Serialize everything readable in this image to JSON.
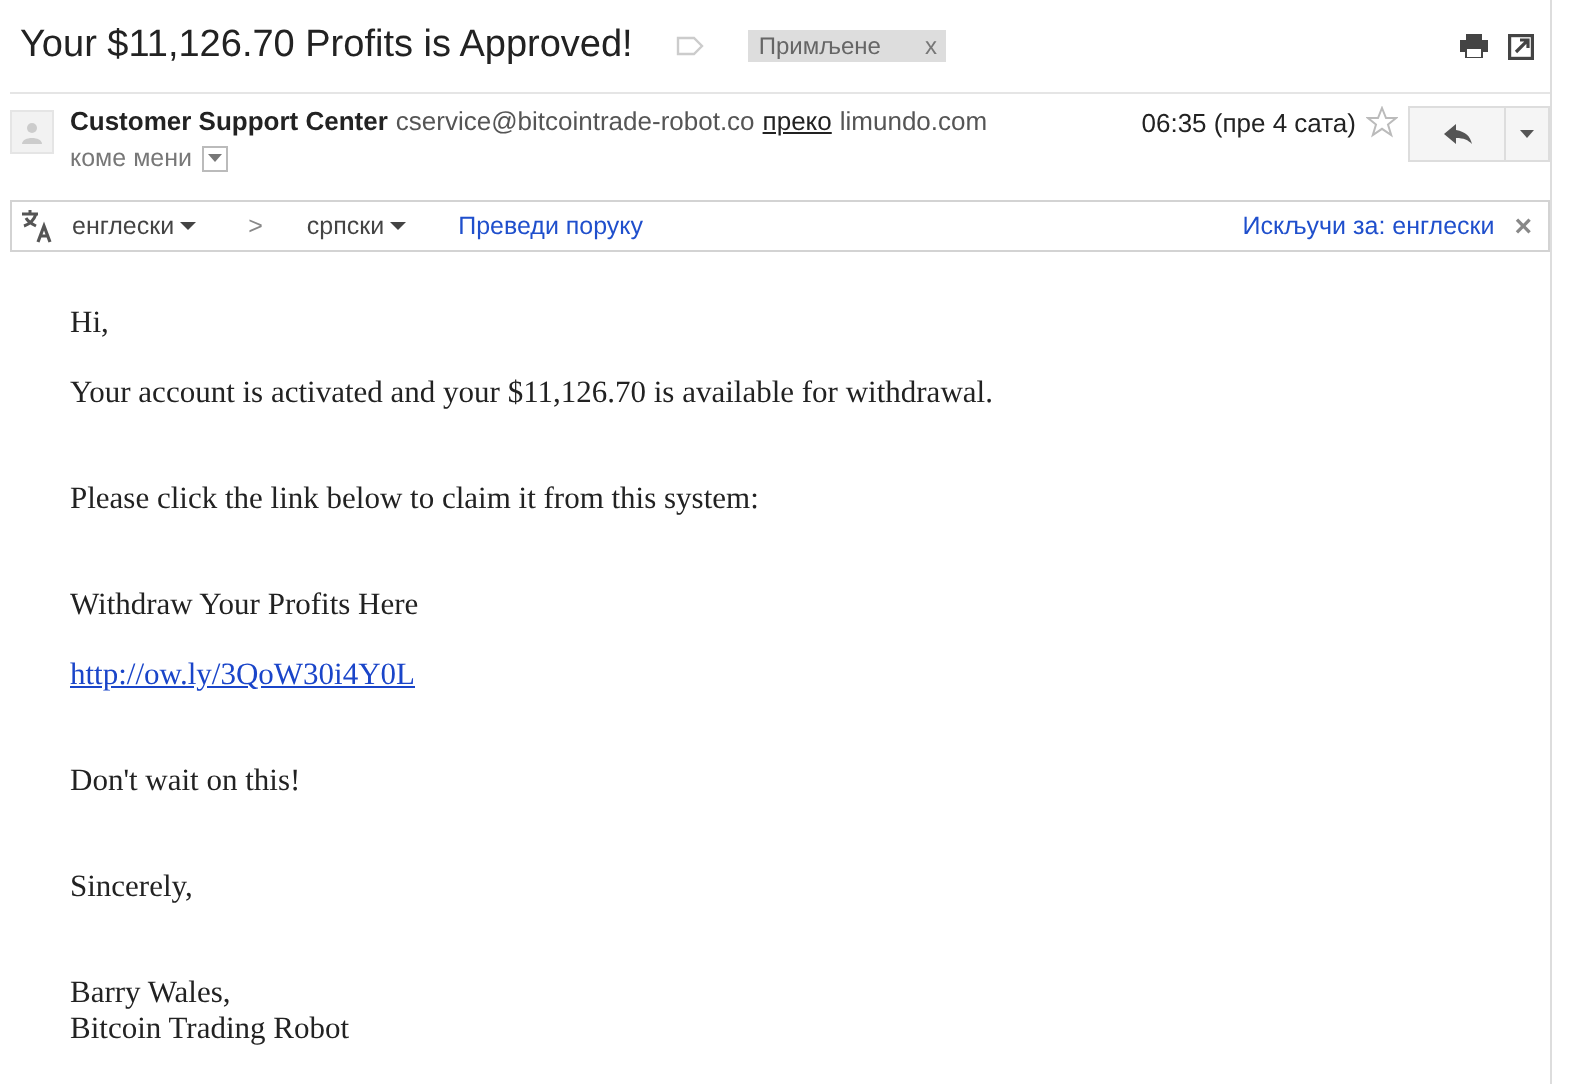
{
  "subject": "Your $11,126.70 Profits is Approved!",
  "labels": [
    {
      "text": "Примљене",
      "remove": "x"
    }
  ],
  "sender": {
    "name": "Customer Support Center",
    "email": "cservice@bitcointrade-robot.co",
    "via": "преко",
    "via_domain": "limundo.com",
    "to": "коме мени",
    "time": "06:35 (пре 4 сата)",
    "starred": false
  },
  "translate_bar": {
    "from": "енглески",
    "separator": ">",
    "to": "српски",
    "action": "Преведи поруку",
    "turn_off": "Искључи за: енглески",
    "close": "×"
  },
  "body": [
    {
      "kind": "text",
      "lines": [
        "Hi,"
      ]
    },
    {
      "kind": "text",
      "lines": [
        "Your account is activated and your $11,126.70 is available for withdrawal."
      ]
    },
    {
      "kind": "text",
      "lines": [
        "Please click the link below to claim it from this system:"
      ]
    },
    {
      "kind": "text",
      "lines": [
        "Withdraw Your Profits Here"
      ]
    },
    {
      "kind": "link",
      "lines": [
        "http://ow.ly/3QoW30i4Y0L"
      ]
    },
    {
      "kind": "text",
      "lines": [
        "Don't wait on this!"
      ]
    },
    {
      "kind": "text",
      "lines": [
        "Sincerely,"
      ]
    },
    {
      "kind": "text",
      "lines": [
        "Barry Wales,",
        "Bitcoin Trading Robot"
      ]
    }
  ]
}
